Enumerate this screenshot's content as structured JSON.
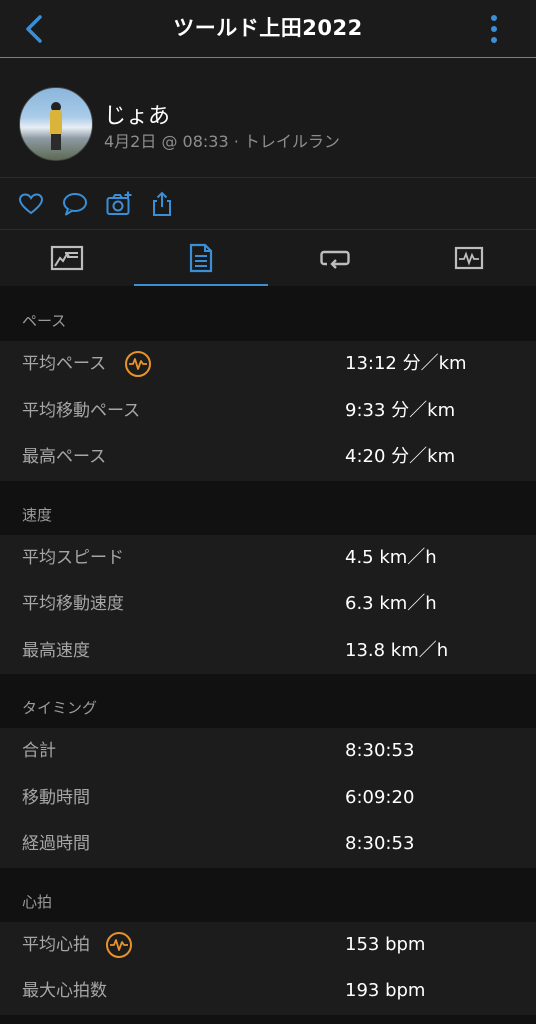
{
  "header": {
    "title": "ツールド上田2022"
  },
  "profile": {
    "username": "じょあ",
    "meta": "4月2日 @ 08:33 · トレイルラン"
  },
  "colors": {
    "accent": "#3a8fd6",
    "badge": "#e8922b",
    "background": "#111111",
    "row_bg": "#1c1c1c"
  },
  "actions": [
    "heart-icon",
    "comment-icon",
    "add-photo-icon",
    "share-icon"
  ],
  "tabs": [
    {
      "icon": "overview-icon",
      "active": false
    },
    {
      "icon": "details-list-icon",
      "active": true
    },
    {
      "icon": "laps-icon",
      "active": false
    },
    {
      "icon": "charts-icon",
      "active": false
    }
  ],
  "sections": {
    "pace": {
      "title": "ペース",
      "rows": [
        {
          "label": "平均ペース",
          "value": "13:12 分／km"
        },
        {
          "label": "平均移動ペース",
          "value": "9:33 分／km"
        },
        {
          "label": "最高ペース",
          "value": "4:20 分／km"
        }
      ]
    },
    "speed": {
      "title": "速度",
      "rows": [
        {
          "label": "平均スピード",
          "value": "4.5 km／h"
        },
        {
          "label": "平均移動速度",
          "value": "6.3 km／h"
        },
        {
          "label": "最高速度",
          "value": "13.8 km／h"
        }
      ]
    },
    "timing": {
      "title": "タイミング",
      "rows": [
        {
          "label": "合計",
          "value": "8:30:53"
        },
        {
          "label": "移動時間",
          "value": "6:09:20"
        },
        {
          "label": "経過時間",
          "value": "8:30:53"
        }
      ]
    },
    "heart": {
      "title": "心拍",
      "rows": [
        {
          "label": "平均心拍",
          "value": "153 bpm"
        },
        {
          "label": "最大心拍数",
          "value": "193 bpm"
        }
      ]
    }
  }
}
